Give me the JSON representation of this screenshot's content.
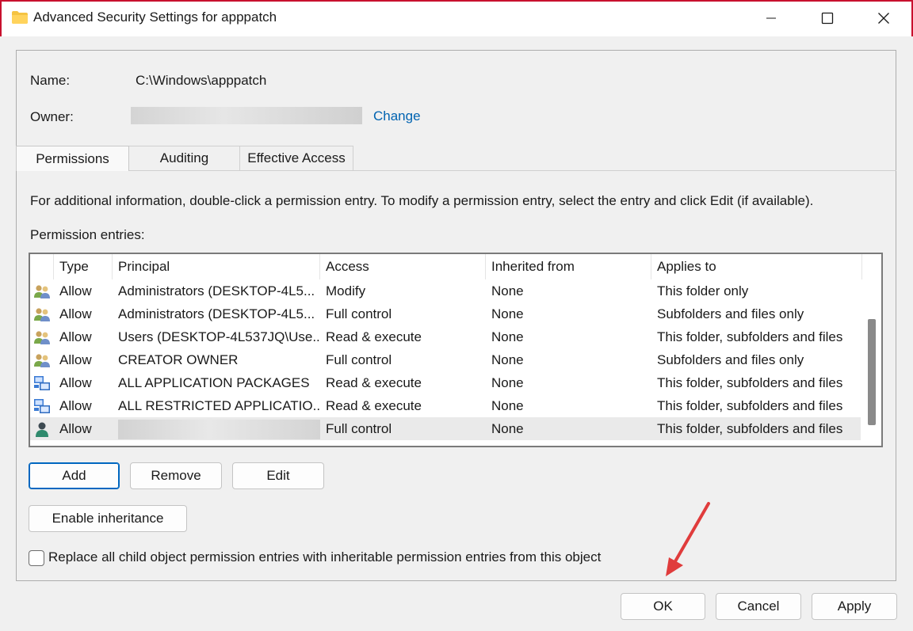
{
  "window": {
    "title": "Advanced Security Settings for apppatch",
    "minimize_icon": "minimize-icon",
    "maximize_icon": "maximize-icon",
    "close_icon": "close-icon"
  },
  "object": {
    "name_label": "Name:",
    "name_value": "C:\\Windows\\apppatch",
    "owner_label": "Owner:",
    "change_link": "Change"
  },
  "tabs": [
    {
      "label": "Permissions",
      "active": true
    },
    {
      "label": "Auditing",
      "active": false
    },
    {
      "label": "Effective Access",
      "active": false
    }
  ],
  "permissions": {
    "info_text": "For additional information, double-click a permission entry. To modify a permission entry, select the entry and click Edit (if available).",
    "entries_label": "Permission entries:",
    "columns": [
      "Type",
      "Principal",
      "Access",
      "Inherited from",
      "Applies to"
    ],
    "rows": [
      {
        "icon": "group-icon",
        "type": "Allow",
        "principal": "Administrators (DESKTOP-4L5...",
        "access": "Modify",
        "inherited": "None",
        "applies": "This folder only"
      },
      {
        "icon": "group-icon",
        "type": "Allow",
        "principal": "Administrators (DESKTOP-4L5...",
        "access": "Full control",
        "inherited": "None",
        "applies": "Subfolders and files only"
      },
      {
        "icon": "group-icon",
        "type": "Allow",
        "principal": "Users (DESKTOP-4L537JQ\\Use...",
        "access": "Read & execute",
        "inherited": "None",
        "applies": "This folder, subfolders and files"
      },
      {
        "icon": "group-icon",
        "type": "Allow",
        "principal": "CREATOR OWNER",
        "access": "Full control",
        "inherited": "None",
        "applies": "Subfolders and files only"
      },
      {
        "icon": "app-packages-icon",
        "type": "Allow",
        "principal": "ALL APPLICATION PACKAGES",
        "access": "Read & execute",
        "inherited": "None",
        "applies": "This folder, subfolders and files"
      },
      {
        "icon": "app-packages-icon",
        "type": "Allow",
        "principal": "ALL RESTRICTED APPLICATIO...",
        "access": "Read & execute",
        "inherited": "None",
        "applies": "This folder, subfolders and files"
      },
      {
        "icon": "user-icon",
        "type": "Allow",
        "principal": "",
        "access": "Full control",
        "inherited": "None",
        "applies": "This folder, subfolders and files",
        "selected": true
      }
    ],
    "add_button": "Add",
    "remove_button": "Remove",
    "edit_button": "Edit",
    "enable_inheritance_button": "Enable inheritance",
    "replace_checkbox_label": "Replace all child object permission entries with inheritable permission entries from this object",
    "replace_checked": false
  },
  "footer": {
    "ok_button": "OK",
    "cancel_button": "Cancel",
    "apply_button": "Apply"
  },
  "colors": {
    "accent": "#0067c0",
    "link": "#0063b1",
    "annotation_arrow": "#e03c3c"
  }
}
